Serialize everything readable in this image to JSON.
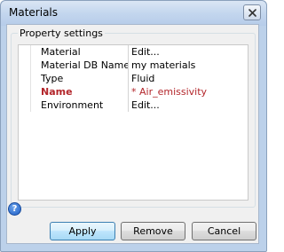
{
  "window": {
    "title": "Materials"
  },
  "group": {
    "label": "Property settings"
  },
  "properties": [
    {
      "name": "Material",
      "value": "Edit..."
    },
    {
      "name": "Material DB Name",
      "value": "my materials"
    },
    {
      "name": "Type",
      "value": "Fluid"
    },
    {
      "name": "Name",
      "value": "* Air_emissivity"
    },
    {
      "name": "Environment",
      "value": "Edit..."
    }
  ],
  "buttons": {
    "apply": "Apply",
    "remove": "Remove",
    "cancel": "Cancel"
  },
  "help": {
    "glyph": "?"
  },
  "colors": {
    "highlight": "#b3262b",
    "default_button": "#a7d9f5"
  }
}
